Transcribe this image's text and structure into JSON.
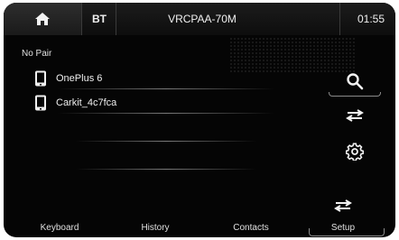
{
  "header": {
    "home_icon": "home-icon",
    "source": "BT",
    "device_name": "VRCPAA-70M",
    "time": "01:55"
  },
  "main": {
    "pair_status": "No Pair",
    "devices": [
      {
        "label": "OnePlus 6",
        "icon": "phone-icon"
      },
      {
        "label": "Carkit_4c7fca",
        "icon": "phone-icon"
      }
    ]
  },
  "side_buttons": [
    {
      "name": "search",
      "icon": "search-icon"
    },
    {
      "name": "connect",
      "icon": "swap-arrows-icon"
    },
    {
      "name": "settings",
      "icon": "gear-icon"
    }
  ],
  "bottom_tabs": {
    "keyboard": "Keyboard",
    "history": "History",
    "contacts": "Contacts",
    "setup": "Setup"
  }
}
